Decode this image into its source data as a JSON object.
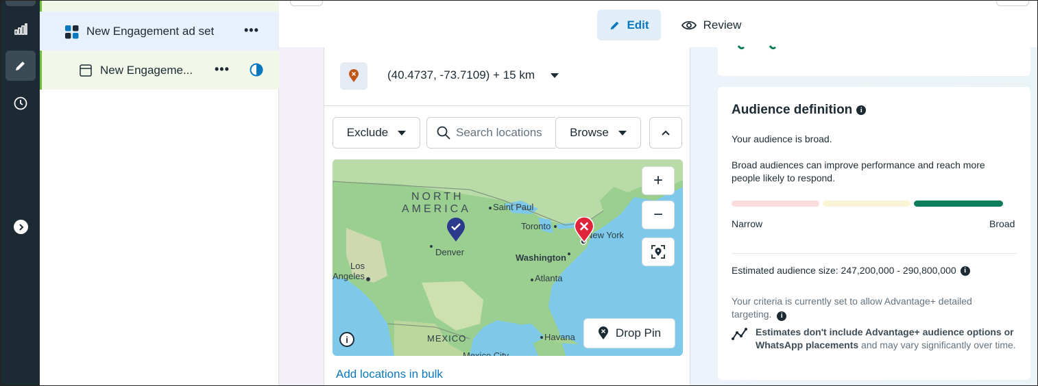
{
  "tree": {
    "adset_label": "New Engagement ad set",
    "ad_label": "New Engageme...",
    "more": "•••"
  },
  "tabs": {
    "edit": "Edit",
    "review": "Review"
  },
  "location": {
    "coords": "(40.4737, -73.7109) + 15 km",
    "exclude_label": "Exclude",
    "search_placeholder": "Search locations",
    "browse_label": "Browse",
    "drop_pin_label": "Drop Pin",
    "add_bulk_label": "Add locations in bulk",
    "map_labels": {
      "north": "NORTH",
      "america": "AMERICA",
      "saint_paul": "Saint Paul",
      "toronto": "Toronto",
      "new_york": "New York",
      "denver": "Denver",
      "washington": "Washington",
      "atlanta": "Atlanta",
      "los": "Los",
      "angeles": "Angeles",
      "mexico": "MEXICO",
      "havana": "Havana",
      "mexico_city": "Mexico City"
    }
  },
  "audience": {
    "title": "Audience definition",
    "broad_line": "Your audience is broad.",
    "broad_desc": "Broad audiences can improve performance and reach more people likely to respond.",
    "narrow_label": "Narrow",
    "broad_label": "Broad",
    "size_line": "Estimated audience size: 247,200,000 - 290,800,000",
    "criteria_line": "Your criteria is currently set to allow Advantage+ detailed targeting.",
    "estimates_bold": "Estimates don't include Advantage+ audience options or WhatsApp placements",
    "estimates_rest": " and may vary significantly over time.",
    "meter_level": "broad",
    "colors": {
      "narrow": "#fbdcdc",
      "mid": "#fbf3d5",
      "broad": "#0b7d5a"
    }
  }
}
